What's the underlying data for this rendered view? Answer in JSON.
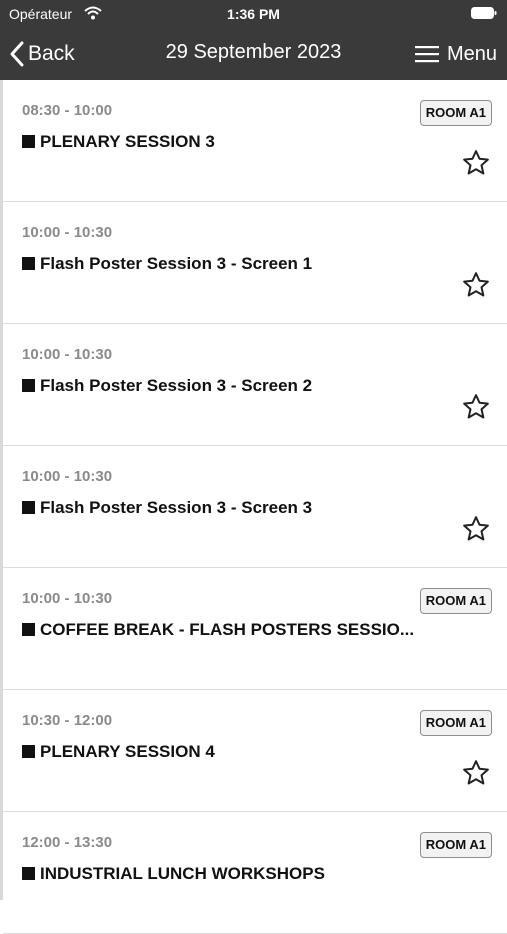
{
  "status": {
    "carrier": "Opérateur",
    "time": "1:36 PM"
  },
  "nav": {
    "back_label": "Back",
    "title": "29 September 2023",
    "menu_label": "Menu"
  },
  "sessions": [
    {
      "time": "08:30 - 10:00",
      "title": "PLENARY SESSION 3",
      "room": "ROOM A1",
      "favorite": false
    },
    {
      "time": "10:00 - 10:30",
      "title": "Flash Poster Session 3 - Screen 1",
      "room": "",
      "favorite": false
    },
    {
      "time": "10:00 - 10:30",
      "title": "Flash Poster Session 3 - Screen 2",
      "room": "",
      "favorite": false
    },
    {
      "time": "10:00 - 10:30",
      "title": "Flash Poster Session 3 - Screen 3",
      "room": "",
      "favorite": false
    },
    {
      "time": "10:00 - 10:30",
      "title": "COFFEE BREAK - FLASH POSTERS SESSIO...",
      "room": "ROOM A1",
      "favorite": null
    },
    {
      "time": "10:30 - 12:00",
      "title": "PLENARY SESSION 4",
      "room": "ROOM A1",
      "favorite": false
    },
    {
      "time": "12:00 - 13:30",
      "title": "INDUSTRIAL LUNCH WORKSHOPS",
      "room": "ROOM A1",
      "favorite": null
    }
  ],
  "colors": {
    "bar": "#3a3a3a",
    "text": "#111111",
    "time": "#8a8a8a",
    "divider": "#dcdcdc"
  },
  "icons": {
    "favorite": "star-outline-icon",
    "back": "chevron-left-icon",
    "menu": "hamburger-icon"
  }
}
